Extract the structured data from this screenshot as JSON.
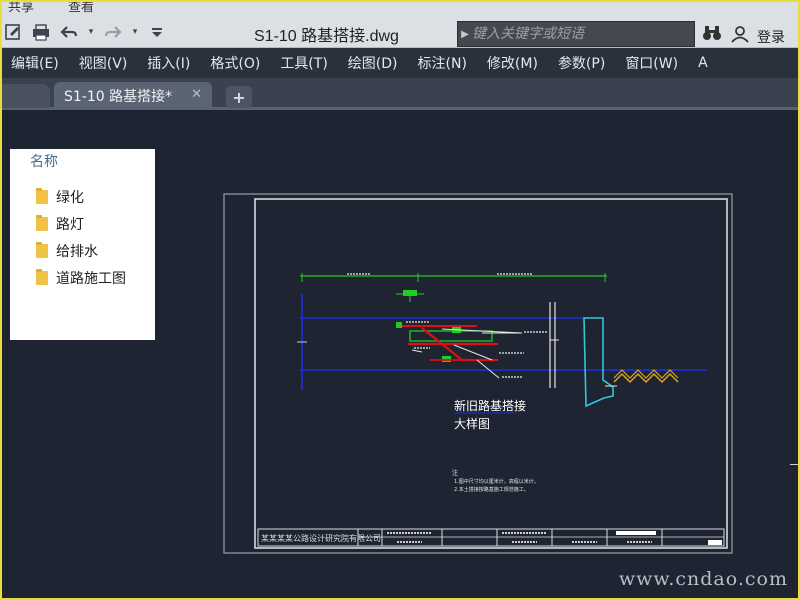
{
  "titlebar": {
    "ribbon_tabs": [
      "共享",
      "查看"
    ],
    "document_title": "S1-10 路基搭接.dwg",
    "search": {
      "placeholder": "键入关键字或短语"
    },
    "login_label": "登录"
  },
  "menubar": {
    "items": [
      "编辑(E)",
      "视图(V)",
      "插入(I)",
      "格式(O)",
      "工具(T)",
      "绘图(D)",
      "标注(N)",
      "修改(M)",
      "参数(P)",
      "窗口(W)",
      "A"
    ]
  },
  "tabs": {
    "active": "S1-10 路基搭接*",
    "close_symbol": "✕",
    "add_symbol": "+"
  },
  "file_panel": {
    "header": "名称",
    "items": [
      "绿化",
      "路灯",
      "给排水",
      "道路施工图"
    ]
  },
  "drawing": {
    "caption_line1": "新旧路基搭接",
    "caption_line2": "大样图",
    "note_heading": "注",
    "note_line1": "1.图中尺寸均以厘米计，高程以米计。",
    "note_line2": "2.本土搭接按路基施工规范施工。",
    "label_topsoil": "土工格栅",
    "label_right": "土工格栅",
    "titleblock_company": "某某某某公路设计研究院有限公司"
  },
  "watermark": "www.cndao.com",
  "colors": {
    "canvas": "#1e2432",
    "blue_line": "#1c2ee0",
    "green": "#22cc22",
    "red": "#dd1111",
    "cyan": "#2ec8d8",
    "orange": "#e0a020",
    "frame": "#d8dce2"
  }
}
